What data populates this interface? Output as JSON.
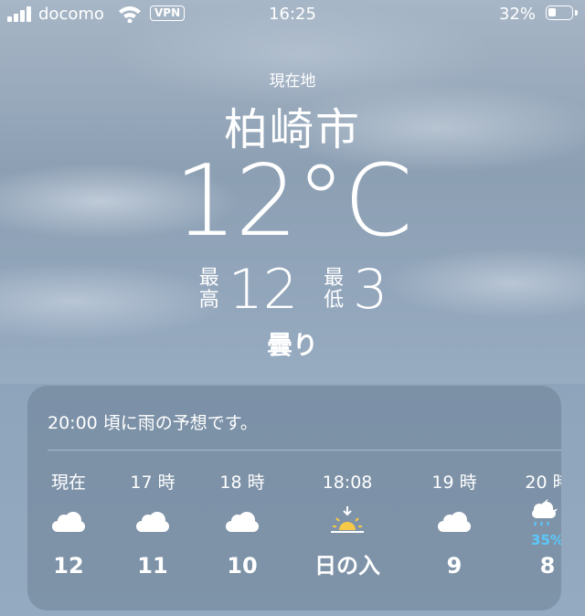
{
  "status_bar": {
    "carrier": "docomo",
    "vpn": "VPN",
    "time": "16:25",
    "battery": "32%"
  },
  "header": {
    "location_label": "現在地",
    "city": "柏崎市",
    "temperature": "12°C",
    "high_label": "最高",
    "high": "12",
    "low_label": "最低",
    "low": "3",
    "condition": "曇り"
  },
  "forecast": {
    "message": "20:00 頃に雨の予想です。",
    "hours": [
      {
        "label": "現在",
        "icon": "cloud-icon",
        "value": "12"
      },
      {
        "label": "17 時",
        "icon": "cloud-icon",
        "value": "11"
      },
      {
        "label": "18 時",
        "icon": "cloud-icon",
        "value": "10"
      },
      {
        "label": "18:08",
        "icon": "sunset-icon",
        "value": "日の入"
      },
      {
        "label": "19 時",
        "icon": "cloud-icon",
        "value": "9"
      },
      {
        "label": "20 時",
        "icon": "cloud-moon-rain-icon",
        "precip": "35%",
        "value": "8"
      }
    ]
  },
  "colors": {
    "precip_accent": "#5ac8fa",
    "sunset_accent": "#f7c948"
  }
}
